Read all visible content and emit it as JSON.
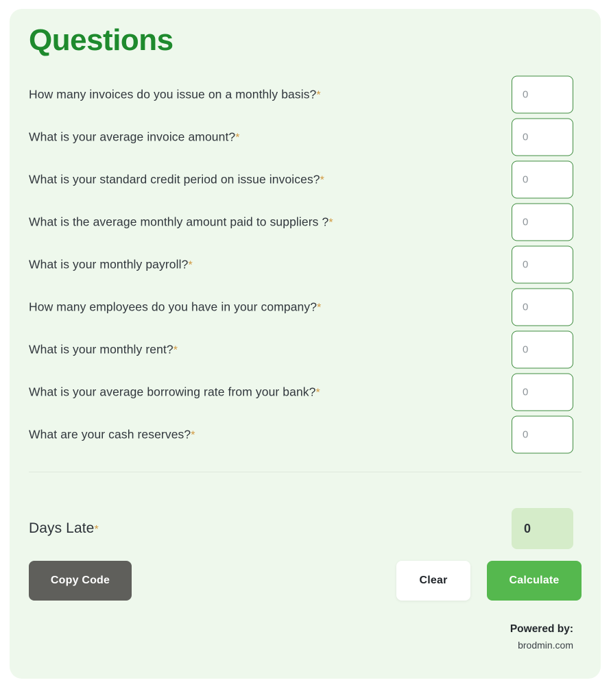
{
  "card": {
    "title": "Questions",
    "required_marker": "*",
    "background": "#eef8ec",
    "title_color": "#1e8a2d",
    "accent_green": "#55b84e",
    "required_color": "#d1983f"
  },
  "questions": [
    {
      "label": "How many invoices do you issue on a monthly basis?",
      "value": "",
      "placeholder": "0"
    },
    {
      "label": "What is your average invoice amount?",
      "value": "",
      "placeholder": "0"
    },
    {
      "label": "What is your standard credit period on issue invoices?",
      "value": "",
      "placeholder": "0"
    },
    {
      "label": "What is the average monthly amount paid to suppliers ?",
      "value": "",
      "placeholder": "0"
    },
    {
      "label": "What is your monthly payroll?",
      "value": "",
      "placeholder": "0"
    },
    {
      "label": "How many employees do you have in your company?",
      "value": "",
      "placeholder": "0"
    },
    {
      "label": "What is your monthly rent?",
      "value": "",
      "placeholder": "0"
    },
    {
      "label": "What is your average borrowing rate from your bank?",
      "value": "",
      "placeholder": "0"
    },
    {
      "label": "What are your cash reserves?",
      "value": "",
      "placeholder": "0"
    }
  ],
  "result": {
    "label": "Days Late",
    "value": "0",
    "box_color": "#d5ecc9"
  },
  "buttons": {
    "copy_code": "Copy Code",
    "clear": "Clear",
    "calculate": "Calculate"
  },
  "footer": {
    "powered_by": "Powered by:",
    "provider": "brodmin.com"
  }
}
